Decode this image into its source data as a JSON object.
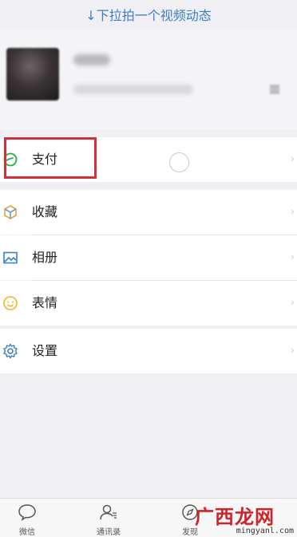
{
  "pull_hint": "↓下拉拍一个视频动态",
  "menu": {
    "pay": {
      "label": "支付",
      "icon": "pay-icon"
    },
    "favorites": {
      "label": "收藏",
      "icon": "cube-icon"
    },
    "album": {
      "label": "相册",
      "icon": "image-icon"
    },
    "stickers": {
      "label": "表情",
      "icon": "smile-icon"
    },
    "settings": {
      "label": "设置",
      "icon": "gear-icon"
    }
  },
  "tabbar": [
    {
      "label": "微信",
      "icon": "chat-bubble-icon"
    },
    {
      "label": "通讯录",
      "icon": "contacts-icon"
    },
    {
      "label": "发现",
      "icon": "compass-icon"
    }
  ],
  "watermark": {
    "logo": "广西龙网",
    "url": "mingyanl.com"
  },
  "colors": {
    "highlight_border": "#d32f3a",
    "accent_blue": "#3c7fc4",
    "pay_green": "#20b04a",
    "background": "#efeff4"
  }
}
